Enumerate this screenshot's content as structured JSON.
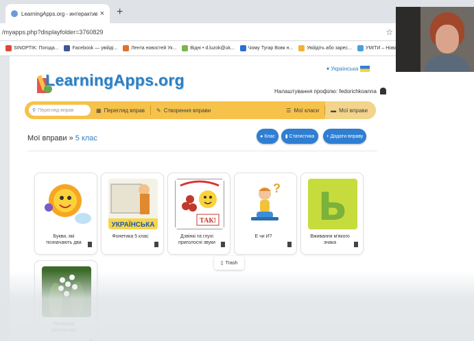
{
  "browser": {
    "tab_title": "LearningApps.org - интерактив",
    "tab_close": "×",
    "new_tab": "+",
    "url": "/myapps.php?displayfolder=3760829",
    "star": "☆",
    "bookmarks": [
      {
        "label": "SINOPTIK: Погода...",
        "color": "#d94a3a"
      },
      {
        "label": "Facebook — увійді...",
        "color": "#3b5998"
      },
      {
        "label": "Лента новостей Ук...",
        "color": "#e0722e"
      },
      {
        "label": "Відні • d.luzok@uk...",
        "color": "#7ab648"
      },
      {
        "label": "Чому Тугар Вовк н...",
        "color": "#2d6fd6"
      },
      {
        "label": "Увійдіть або зарес...",
        "color": "#f2b233"
      },
      {
        "label": "УМІТИ – Нова плат",
        "color": "#4aa0d8"
      }
    ]
  },
  "header": {
    "logo": "LearningApps.org",
    "language": "Українська",
    "profile": "Налаштування профілю: fedorichkoanna"
  },
  "nav": {
    "search_placeholder": "Перегляд вправ",
    "browse": "Перегляд вправ",
    "create": "Створення вправи",
    "classes": "Мої класи",
    "my_apps": "Мої вправи"
  },
  "crumb": {
    "root": "Мої вправи",
    "sep": " » ",
    "folder": "5 клас"
  },
  "buttons": {
    "class": "Клас",
    "stats": "Статистика",
    "add": "+ Додати вправу"
  },
  "cards": [
    {
      "title": "Букви, які позначають два"
    },
    {
      "title": "Фонетика 5 клас",
      "image_text": "УКРАЇНСЬКА"
    },
    {
      "title": "Дзвінкі та глухі приголосні звуки",
      "image_text": "ТАК!"
    },
    {
      "title": "Е чи И?"
    },
    {
      "title": "Вживання м'якого знака",
      "image_text": "Ь"
    },
    {
      "title": "Уживання апострофа"
    }
  ],
  "trash": "Trash"
}
